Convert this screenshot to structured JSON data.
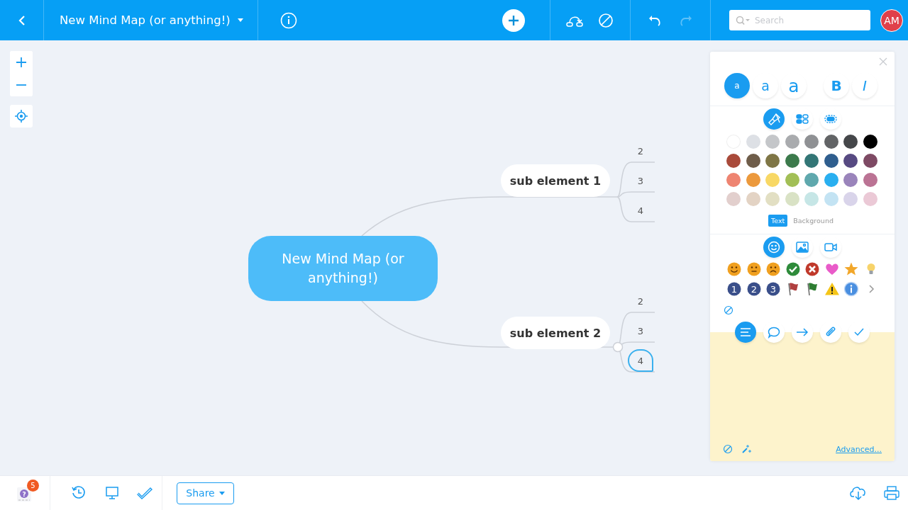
{
  "header": {
    "title": "New Mind Map (or anything!)",
    "undo": {
      "disabled": false
    },
    "redo": {
      "disabled": true
    },
    "search": {
      "placeholder": "Search"
    },
    "avatar": "AM"
  },
  "map": {
    "root": "New Mind Map (or anything!)",
    "branches": [
      {
        "label": "sub element 1",
        "children": [
          {
            "label": "2",
            "selected": false
          },
          {
            "label": "3",
            "selected": false
          },
          {
            "label": "4",
            "selected": false
          }
        ]
      },
      {
        "label": "sub element 2",
        "children": [
          {
            "label": "2",
            "selected": false
          },
          {
            "label": "3",
            "selected": false
          },
          {
            "label": "4",
            "selected": true
          }
        ]
      }
    ]
  },
  "panel": {
    "text_styles": [
      {
        "label": "a",
        "kind": "small",
        "selected": true
      },
      {
        "label": "a",
        "kind": "medium",
        "selected": false
      },
      {
        "label": "a",
        "kind": "large",
        "selected": false
      },
      {
        "label": "B",
        "kind": "bold",
        "selected": false
      },
      {
        "label": "I",
        "kind": "italic",
        "selected": false
      }
    ],
    "style_tabs": [
      {
        "kind": "brush",
        "selected": true
      },
      {
        "kind": "shapes",
        "selected": false
      },
      {
        "kind": "border",
        "selected": false
      }
    ],
    "colors": [
      {
        "color": "#ffffff"
      },
      {
        "color": "#dde0e5"
      },
      {
        "color": "#c4c6c9"
      },
      {
        "color": "#a9abae"
      },
      {
        "color": "#8f9194"
      },
      {
        "color": "#626466"
      },
      {
        "color": "#45474a"
      },
      {
        "color": "#000000"
      },
      {
        "color": "#a94a3a"
      },
      {
        "color": "#6f5d4a"
      },
      {
        "color": "#7f7646"
      },
      {
        "color": "#3c7a4c"
      },
      {
        "color": "#337676"
      },
      {
        "color": "#2f5e8e"
      },
      {
        "color": "#574a82"
      },
      {
        "color": "#7e4a64"
      },
      {
        "color": "#ee8471"
      },
      {
        "color": "#ec993c"
      },
      {
        "color": "#f8d865"
      },
      {
        "color": "#a2bf56"
      },
      {
        "color": "#5fa8ad"
      },
      {
        "color": "#29aff0"
      },
      {
        "color": "#9a84bb"
      },
      {
        "color": "#bb7394"
      },
      {
        "color": "#e2cfcd"
      },
      {
        "color": "#e3d3c4"
      },
      {
        "color": "#e2dfc3"
      },
      {
        "color": "#d9e2c5"
      },
      {
        "color": "#c6e6e6"
      },
      {
        "color": "#c3e3f3"
      },
      {
        "color": "#d9d4ea"
      },
      {
        "color": "#ebc9d6"
      }
    ],
    "color_targets": [
      {
        "label": "Text",
        "selected": true
      },
      {
        "label": "Background",
        "selected": false
      }
    ],
    "media_tabs": [
      {
        "kind": "emoji",
        "selected": true
      },
      {
        "kind": "image",
        "selected": false
      },
      {
        "kind": "video",
        "selected": false
      }
    ],
    "icons": [
      {
        "kind": "smile"
      },
      {
        "kind": "neutral"
      },
      {
        "kind": "sad"
      },
      {
        "kind": "check"
      },
      {
        "kind": "cross"
      },
      {
        "kind": "heart"
      },
      {
        "kind": "star"
      },
      {
        "kind": "bulb"
      },
      {
        "kind": "number",
        "label": "1"
      },
      {
        "kind": "number",
        "label": "2"
      },
      {
        "kind": "number",
        "label": "3"
      },
      {
        "kind": "flag",
        "color": "#b04040"
      },
      {
        "kind": "flag",
        "color": "#2e7d32"
      },
      {
        "kind": "warning"
      },
      {
        "kind": "info"
      }
    ],
    "note_tabs": [
      {
        "kind": "notes",
        "selected": true
      },
      {
        "kind": "comment",
        "selected": false
      },
      {
        "kind": "link",
        "selected": false
      },
      {
        "kind": "attachment",
        "selected": false
      },
      {
        "kind": "task",
        "selected": false
      }
    ],
    "advanced_link": "Advanced..."
  },
  "footer": {
    "help_glyph": "?",
    "help_badge": "5",
    "share": "Share"
  }
}
